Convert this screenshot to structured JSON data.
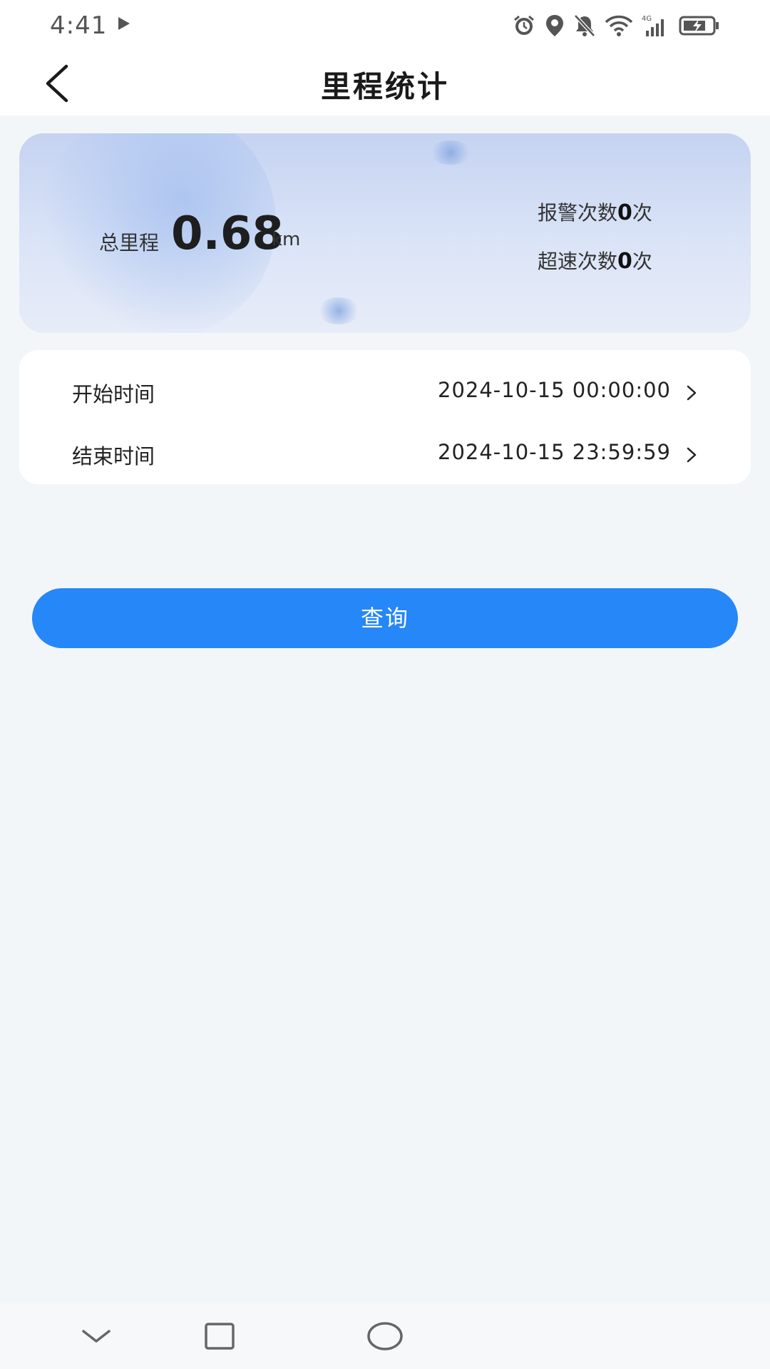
{
  "status_bar": {
    "time": "4:41",
    "icons": [
      "play-icon",
      "alarm-icon",
      "location-icon",
      "mute-icon",
      "wifi-icon",
      "signal-4g-icon",
      "battery-charging-icon"
    ]
  },
  "header": {
    "title": "里程统计",
    "back_icon": "chevron-left-icon"
  },
  "summary": {
    "total_label": "总里程",
    "total_value": "0.68",
    "total_unit": "km",
    "alarm_label": "报警次数",
    "alarm_count": "0",
    "alarm_unit": "次",
    "speeding_label": "超速次数",
    "speeding_count": "0",
    "speeding_unit": "次"
  },
  "time_range": {
    "start_label": "开始时间",
    "start_value": "2024-10-15 00:00:00",
    "end_label": "结束时间",
    "end_value": "2024-10-15 23:59:59"
  },
  "actions": {
    "query_label": "查询"
  },
  "colors": {
    "accent": "#2587f8",
    "background": "#f3f6f9",
    "card": "#ffffff"
  }
}
